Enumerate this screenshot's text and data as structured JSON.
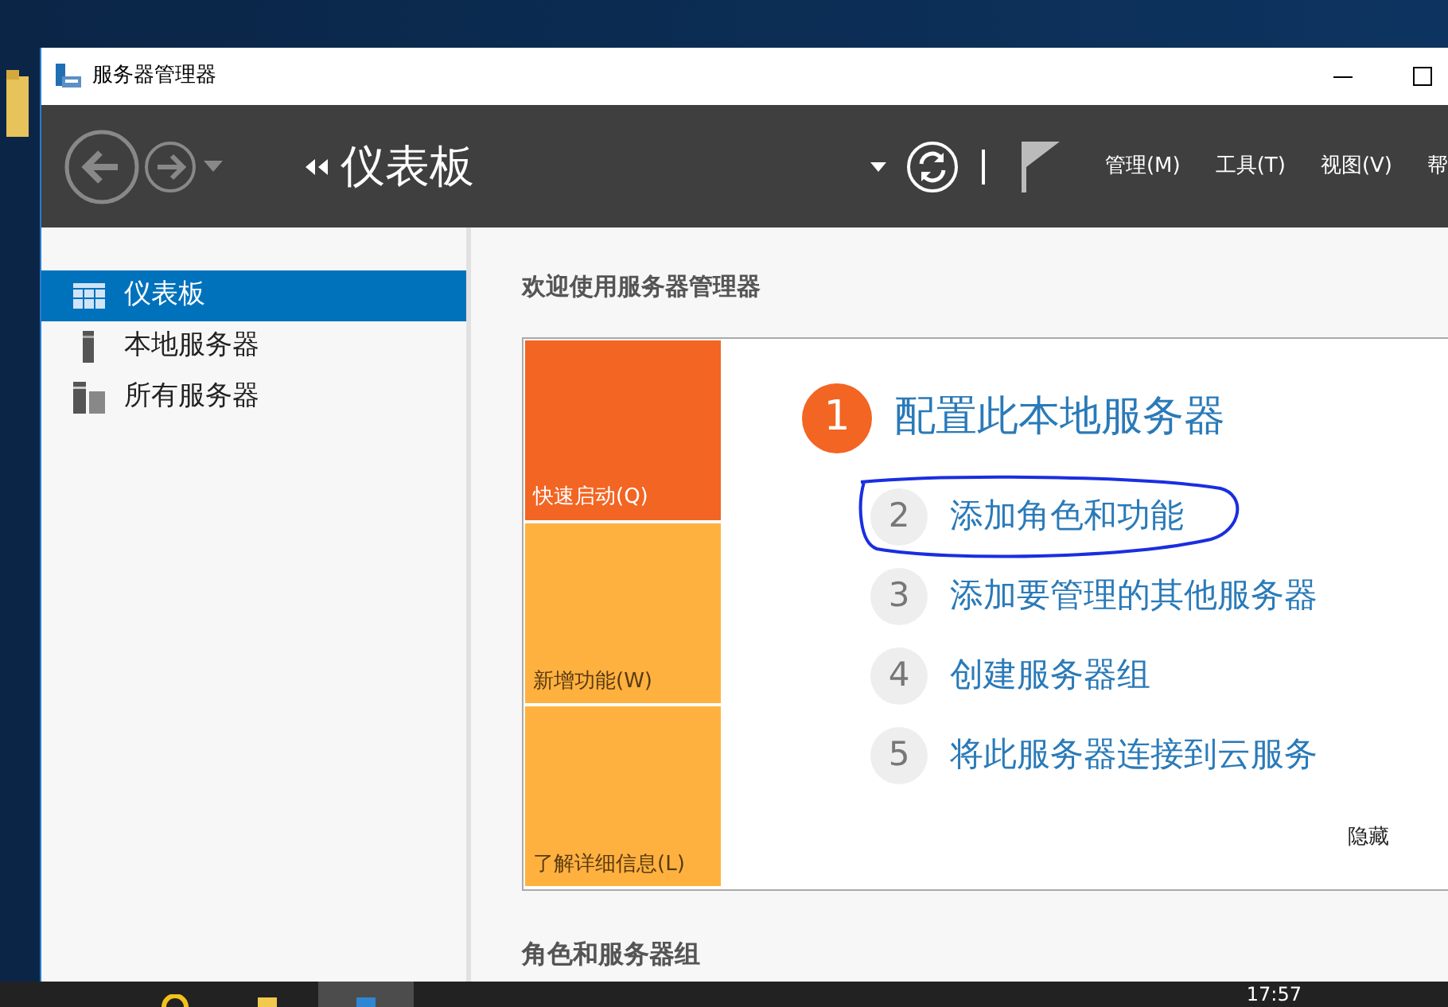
{
  "window": {
    "title": "服务器管理器"
  },
  "toolbar": {
    "breadcrumb": "仪表板",
    "menus": [
      "管理(M)",
      "工具(T)",
      "视图(V)",
      "帮"
    ]
  },
  "sidebar": {
    "items": [
      {
        "label": "仪表板",
        "selected": true,
        "kind": "dashboard"
      },
      {
        "label": "本地服务器",
        "selected": false,
        "kind": "server"
      },
      {
        "label": "所有服务器",
        "selected": false,
        "kind": "servers"
      }
    ]
  },
  "welcome": {
    "heading": "欢迎使用服务器管理器",
    "tiles": [
      {
        "label": "快速启动(Q)",
        "selected": true
      },
      {
        "label": "新增功能(W)",
        "selected": false
      },
      {
        "label": "了解详细信息(L)",
        "selected": false
      }
    ],
    "steps": [
      {
        "number": "1",
        "label": "配置此本地服务器",
        "kind": "primary",
        "circled": false
      },
      {
        "number": "2",
        "label": "添加角色和功能",
        "kind": "secondary",
        "circled": true
      },
      {
        "number": "3",
        "label": "添加要管理的其他服务器",
        "kind": "secondary",
        "circled": false
      },
      {
        "number": "4",
        "label": "创建服务器组",
        "kind": "secondary",
        "circled": false
      },
      {
        "number": "5",
        "label": "将此服务器连接到云服务",
        "kind": "secondary",
        "circled": false
      }
    ],
    "hide": "隐藏"
  },
  "section": {
    "heading": "角色和服务器组"
  },
  "taskbar": {
    "time": "17:57"
  }
}
